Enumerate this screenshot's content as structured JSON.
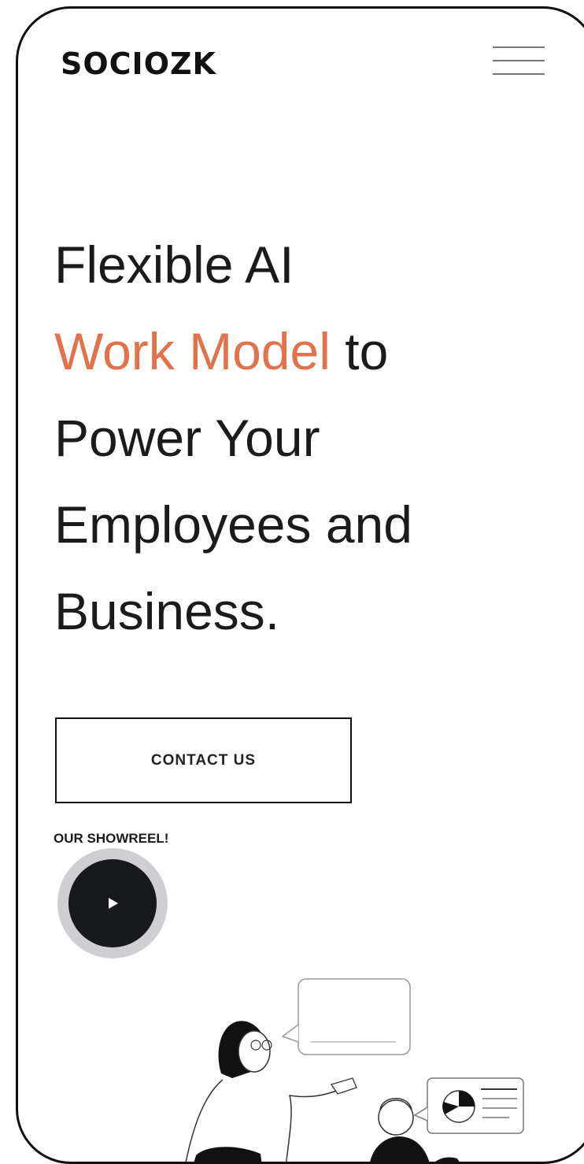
{
  "header": {
    "logo_text": "SOCIOZK",
    "menu_icon": "hamburger-menu-icon"
  },
  "hero": {
    "headline_line1": "Flexible AI",
    "headline_accent": "Work Model",
    "headline_after_accent": " to",
    "headline_line3": "Power Your",
    "headline_line4": "Employees and",
    "headline_line5": "Business.",
    "accent_color": "#e2724a",
    "contact_label": "CONTACT US",
    "showreel_label": "OUR SHOWREEL!",
    "play_icon": "play-icon"
  },
  "illustration": {
    "icon": "people-chatting-illustration"
  }
}
